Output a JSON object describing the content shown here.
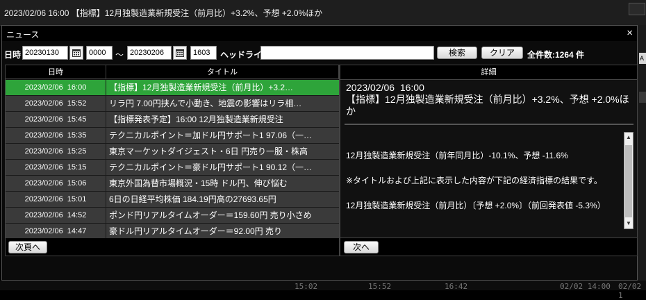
{
  "topbar": {
    "ticker": "2023/02/06 16:00 【指標】12月独製造業新規受注（前月比）+3.2%、予想 +2.0%ほか"
  },
  "window": {
    "title": "ニュース",
    "close_glyph": "×"
  },
  "search": {
    "date_label": "日時",
    "from_date": "20230130",
    "from_time": "0000",
    "range_sep": "〜",
    "to_date": "20230206",
    "to_time": "1603",
    "headline_label": "ヘッドライン",
    "headline_value": "",
    "search_btn": "検索",
    "clear_btn": "クリア",
    "total": "全件数:1264 件"
  },
  "list": {
    "col_date": "日時",
    "col_title": "タイトル",
    "rows": [
      {
        "date": "2023/02/06  16:00",
        "title": "【指標】12月独製造業新規受注（前月比）+3.2…",
        "selected": true
      },
      {
        "date": "2023/02/06  15:52",
        "title": "リラ円  7.00円挟んで小動き、地震の影響はリラ相…"
      },
      {
        "date": "2023/02/06  15:45",
        "title": "【指標発表予定】16:00  12月独製造業新規受注"
      },
      {
        "date": "2023/02/06  15:35",
        "title": "テクニカルポイント＝加ドル円サポート1  97.06（一…"
      },
      {
        "date": "2023/02/06  15:25",
        "title": "東京マーケットダイジェスト・6日  円売り一服・株高"
      },
      {
        "date": "2023/02/06  15:15",
        "title": "テクニカルポイント＝豪ドル円サポート1  90.12（一…"
      },
      {
        "date": "2023/02/06  15:06",
        "title": "東京外国為替市場概況・15時  ドル円、伸び悩む"
      },
      {
        "date": "2023/02/06  15:01",
        "title": "6日の日経平均株価  184.19円高の27693.65円"
      },
      {
        "date": "2023/02/06  14:52",
        "title": "ポンド円リアルタイムオーダー＝159.60円  売り小さめ"
      },
      {
        "date": "2023/02/06  14:47",
        "title": "豪ドル円リアルタイムオーダー＝92.00円  売り"
      }
    ],
    "next_page_btn": "次頁へ"
  },
  "detail": {
    "header": "詳細",
    "timestamp": "2023/02/06  16:00",
    "title": "【指標】12月独製造業新規受注（前月比）+3.2%、予想 +2.0%ほか",
    "body1": "12月独製造業新規受注（前年同月比）-10.1%、予想 -11.6%",
    "body2": "※タイトルおよび上記に表示した内容が下記の経済指標の結果です。",
    "body3": "12月独製造業新規受注（前月比）〔予想 +2.0%〕（前回発表値 -5.3%）",
    "next_btn": "次へ"
  },
  "background": {
    "side_tab": "A",
    "axis_labels": [
      "15:02",
      "15:52",
      "16:42",
      "02/02 14:00",
      "02/02 1"
    ]
  }
}
